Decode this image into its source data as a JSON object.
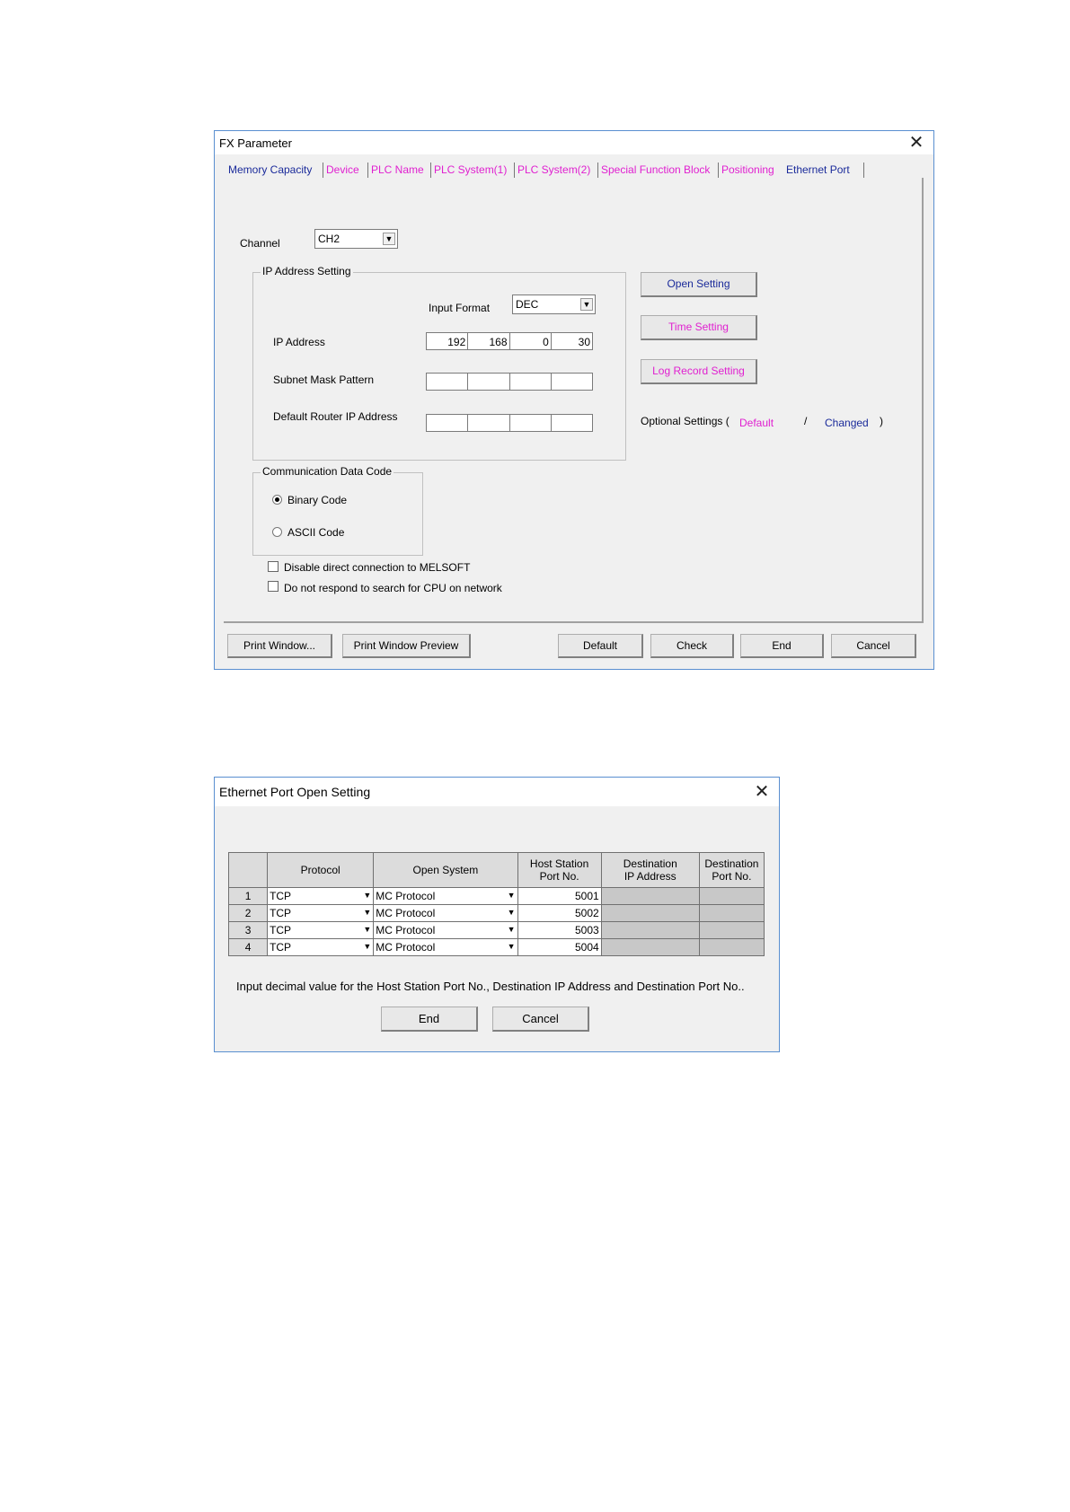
{
  "fx": {
    "title": "FX Parameter",
    "close": "✕",
    "tabs": [
      {
        "label": "Memory Capacity"
      },
      {
        "label": "Device"
      },
      {
        "label": "PLC Name"
      },
      {
        "label": "PLC System(1)"
      },
      {
        "label": "PLC System(2)"
      },
      {
        "label": "Special Function Block"
      },
      {
        "label": "Positioning"
      },
      {
        "label": "Ethernet Port"
      }
    ],
    "channel_label": "Channel",
    "channel_value": "CH2",
    "ip_group_title": "IP Address Setting",
    "input_format_label": "Input Format",
    "input_format_value": "DEC",
    "ip_address_label": "IP Address",
    "ip_address": [
      "192",
      "168",
      "0",
      "30"
    ],
    "subnet_label": "Subnet Mask Pattern",
    "router_label": "Default Router IP Address",
    "comm_group_title": "Communication Data Code",
    "binary_label": "Binary Code",
    "ascii_label": "ASCII Code",
    "disable_direct_label": "Disable direct connection to MELSOFT",
    "no_respond_label": "Do not respond to search for CPU on network",
    "open_setting": "Open Setting",
    "time_setting": "Time Setting",
    "log_setting": "Log Record Setting",
    "optional_label": "Optional Settings (",
    "optional_default": "Default",
    "optional_slash": "/",
    "optional_changed": "Changed",
    "optional_close": ")",
    "buttons": {
      "print_window": "Print Window...",
      "print_preview": "Print Window Preview",
      "default": "Default",
      "check": "Check",
      "end": "End",
      "cancel": "Cancel"
    }
  },
  "open": {
    "title": "Ethernet Port Open Setting",
    "close": "✕",
    "headers": {
      "protocol": "Protocol",
      "open_system": "Open System",
      "host_port_1": "Host Station",
      "host_port_2": "Port No.",
      "dest_ip_1": "Destination",
      "dest_ip_2": "IP Address",
      "dest_port_1": "Destination",
      "dest_port_2": "Port No."
    },
    "rows": [
      {
        "no": "1",
        "protocol": "TCP",
        "open_system": "MC Protocol",
        "port": "5001"
      },
      {
        "no": "2",
        "protocol": "TCP",
        "open_system": "MC Protocol",
        "port": "5002"
      },
      {
        "no": "3",
        "protocol": "TCP",
        "open_system": "MC Protocol",
        "port": "5003"
      },
      {
        "no": "4",
        "protocol": "TCP",
        "open_system": "MC Protocol",
        "port": "5004"
      }
    ],
    "note": "Input decimal value for the Host Station Port No., Destination IP Address and Destination Port No..",
    "end": "End",
    "cancel": "Cancel"
  }
}
